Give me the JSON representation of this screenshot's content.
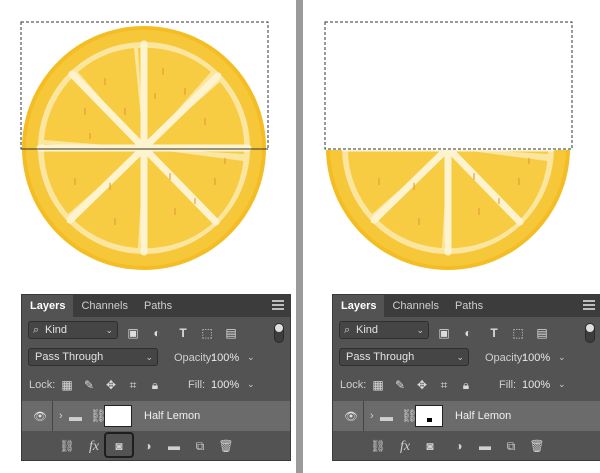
{
  "colors": {
    "panel_bg": "#535353",
    "tab_bar": "#3c3c3c",
    "layer_row": "#6b6b6b",
    "lemon_rind_outer": "#f2b81c",
    "lemon_rind_inner": "#fbe89a",
    "lemon_flesh": "#f7c940",
    "divider": "#9a9a9a"
  },
  "panels": [
    {
      "tabs": [
        "Layers",
        "Channels",
        "Paths"
      ],
      "filter_kind": "Kind",
      "filter_icons": [
        "image-filter-icon",
        "adjustment-filter-icon",
        "type-filter-icon",
        "shape-filter-icon",
        "smart-object-filter-icon"
      ],
      "blend_mode": "Pass Through",
      "opacity_label": "Opacity:",
      "opacity_value": "100%",
      "lock_label": "Lock:",
      "fill_label": "Fill:",
      "fill_value": "100%",
      "layer_name": "Half Lemon",
      "mask_shows_dot": false
    },
    {
      "tabs": [
        "Layers",
        "Channels",
        "Paths"
      ],
      "filter_kind": "Kind",
      "filter_icons": [
        "image-filter-icon",
        "adjustment-filter-icon",
        "type-filter-icon",
        "shape-filter-icon",
        "smart-object-filter-icon"
      ],
      "blend_mode": "Pass Through",
      "opacity_label": "Opacity:",
      "opacity_value": "100%",
      "lock_label": "Lock:",
      "fill_label": "Fill:",
      "fill_value": "100%",
      "layer_name": "Half Lemon",
      "mask_shows_dot": true
    }
  ],
  "bottom_icons": [
    "link-layers-icon",
    "fx-icon",
    "add-mask-icon",
    "adjustment-layer-icon",
    "new-group-icon",
    "new-layer-icon",
    "trash-icon"
  ],
  "fx_text": "fx",
  "type_glyph": "T"
}
